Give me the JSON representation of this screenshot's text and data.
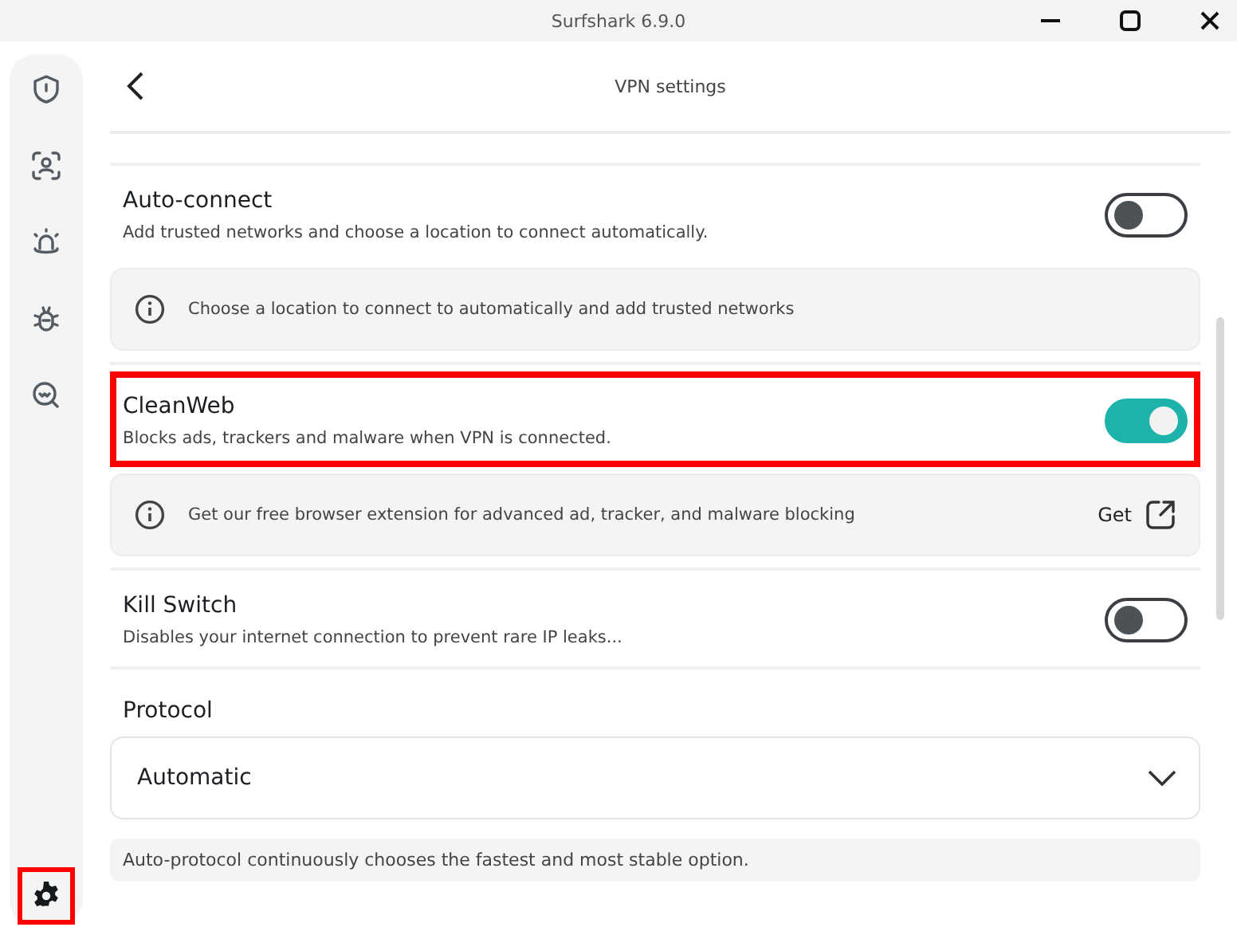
{
  "window": {
    "title": "Surfshark 6.9.0"
  },
  "sidebar": {
    "items": [
      {
        "selected": false,
        "highlighted": false
      },
      {
        "selected": false,
        "highlighted": false
      },
      {
        "selected": false,
        "highlighted": false
      },
      {
        "selected": false,
        "highlighted": false
      },
      {
        "selected": false,
        "highlighted": false
      },
      {
        "selected": true,
        "highlighted": true
      }
    ]
  },
  "header": {
    "title": "VPN settings"
  },
  "sections": [
    {
      "kind": "toggle",
      "title": "Auto-connect",
      "description": "Add trusted networks and choose a location to connect automatically.",
      "on": false,
      "highlighted": false
    },
    {
      "kind": "info",
      "text": "Choose a location to connect to automatically and add trusted networks"
    },
    {
      "kind": "toggle",
      "title": "CleanWeb",
      "description": "Blocks ads, trackers and malware when VPN is connected.",
      "on": true,
      "highlighted": true
    },
    {
      "kind": "info",
      "text": "Get our free browser extension for advanced ad, tracker, and malware blocking",
      "action": "Get"
    },
    {
      "kind": "toggle",
      "title": "Kill Switch",
      "description": "Disables your internet connection to prevent rare IP leaks...",
      "on": false,
      "highlighted": false
    },
    {
      "kind": "heading",
      "text": "Protocol"
    },
    {
      "kind": "dropdown",
      "value": "Automatic"
    },
    {
      "kind": "hint",
      "text": "Auto-protocol continuously chooses the fastest and most stable option."
    }
  ]
}
